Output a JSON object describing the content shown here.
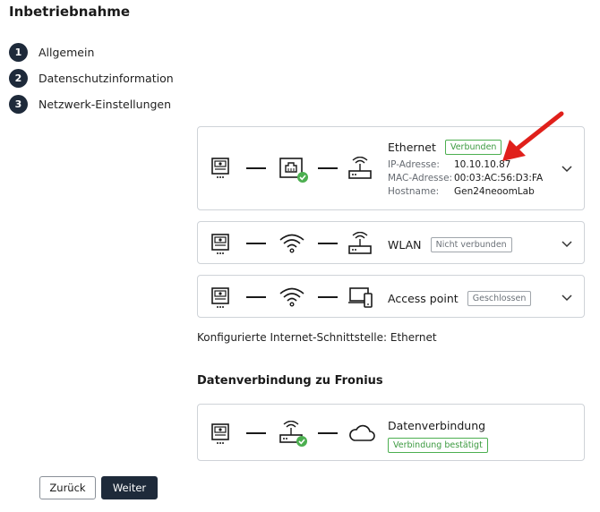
{
  "page": {
    "title": "Inbetriebnahme"
  },
  "steps": [
    {
      "num": "1",
      "label": "Allgemein"
    },
    {
      "num": "2",
      "label": "Datenschutzinformation"
    },
    {
      "num": "3",
      "label": "Netzwerk-Einstellungen"
    }
  ],
  "ethernet": {
    "title": "Ethernet",
    "status": "Verbunden",
    "ip_label": "IP-Adresse:",
    "ip_value": "10.10.10.87",
    "mac_label": "MAC-Adresse:",
    "mac_value": "00:03:AC:56:D3:FA",
    "host_label": "Hostname:",
    "host_value": "Gen24neoomLab"
  },
  "wlan": {
    "title": "WLAN",
    "status": "Nicht verbunden"
  },
  "access_point": {
    "title": "Access point",
    "status": "Geschlossen"
  },
  "configured_interface": "Konfigurierte Internet-Schnittstelle: Ethernet",
  "fronius": {
    "section_title": "Datenverbindung zu Fronius",
    "title": "Datenverbindung",
    "status": "Verbindung bestätigt"
  },
  "buttons": {
    "back": "Zurück",
    "next": "Weiter"
  },
  "colors": {
    "dark": "#1e2a3a",
    "success": "#4caf50",
    "annotation_arrow": "#e0201b"
  }
}
